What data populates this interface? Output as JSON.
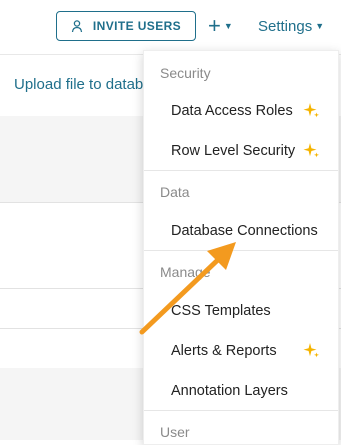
{
  "header": {
    "invite_users_label": "INVITE USERS",
    "plus_label": "+",
    "settings_label": "Settings"
  },
  "main": {
    "upload_link": "Upload file to datab"
  },
  "settings_dropdown": {
    "sections": [
      {
        "label": "Security",
        "items": [
          {
            "label": "Data Access Roles",
            "badge": "sparkle-icon"
          },
          {
            "label": "Row Level Security",
            "badge": "sparkle-icon"
          }
        ]
      },
      {
        "label": "Data",
        "items": [
          {
            "label": "Database Connections"
          }
        ]
      },
      {
        "label": "Manage",
        "items": [
          {
            "label": "CSS Templates"
          },
          {
            "label": "Alerts & Reports",
            "badge": "sparkle-icon"
          },
          {
            "label": "Annotation Layers"
          }
        ]
      },
      {
        "label": "User",
        "items": []
      }
    ]
  },
  "colors": {
    "accent": "#1f6f8b",
    "sparkle": "#f5b400",
    "arrow": "#f39a1f"
  }
}
